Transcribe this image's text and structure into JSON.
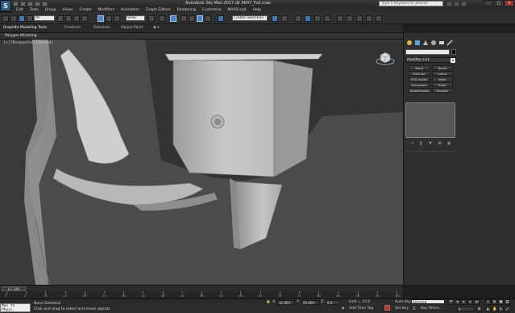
{
  "window": {
    "logo": "S",
    "title": "Autodesk 3ds Max 2017.dll  AK47_Full.max",
    "search_placeholder": "Type a keyword or phrase"
  },
  "menu": [
    "Edit",
    "Tools",
    "Group",
    "Views",
    "Create",
    "Modifiers",
    "Animation",
    "Graph Editors",
    "Rendering",
    "Customize",
    "MAXScript",
    "Help"
  ],
  "toolbar": {
    "undo_dropdown": "All",
    "view_dropdown": "View",
    "selection_set": "Create Selection Se"
  },
  "ribbon": {
    "tabs": [
      "Graphite Modeling Tools",
      "Freeform",
      "Selection",
      "Object Paint"
    ],
    "panel_label": "Polygon Modeling"
  },
  "viewport": {
    "label": "[+] [Perspective] [Shaded]"
  },
  "command_panel": {
    "modifier_list": "Modifier List",
    "buttons": [
      "Bend",
      "Bevel",
      "Extrude",
      "Lathe",
      "FFD 3x3x3",
      "Shell",
      "Symmetry",
      "Taper",
      "TurboSmooth",
      "Smooth"
    ]
  },
  "timeline": {
    "position": "0 / 100",
    "ticks": [
      "0",
      "5",
      "10",
      "15",
      "20",
      "25",
      "30",
      "35",
      "40",
      "45",
      "50",
      "55",
      "60",
      "65",
      "70",
      "75",
      "80",
      "85",
      "90",
      "95",
      "100"
    ]
  },
  "status": {
    "maxscript": "Max to Physc.",
    "selection": "None Selected",
    "hint": "Click and drag to select and move objects",
    "x_label": "X:",
    "x_value": "11.903",
    "y_label": "Y:",
    "y_value": "55.069",
    "z_label": "Z:",
    "z_value": "0.0",
    "grid": "Grid = 10.0",
    "add_time_tag": "Add Time Tag",
    "auto_key": "Auto Key",
    "auto_key_mode": "Selected",
    "set_key": "Set Key",
    "key_filters": "Key Filters...",
    "frame": "0"
  },
  "colors": {
    "viewport_bg": "#4b4b4b",
    "model": "#c8c8c8",
    "accent": "#3c7bb8",
    "auto_key": "#b0392e"
  }
}
